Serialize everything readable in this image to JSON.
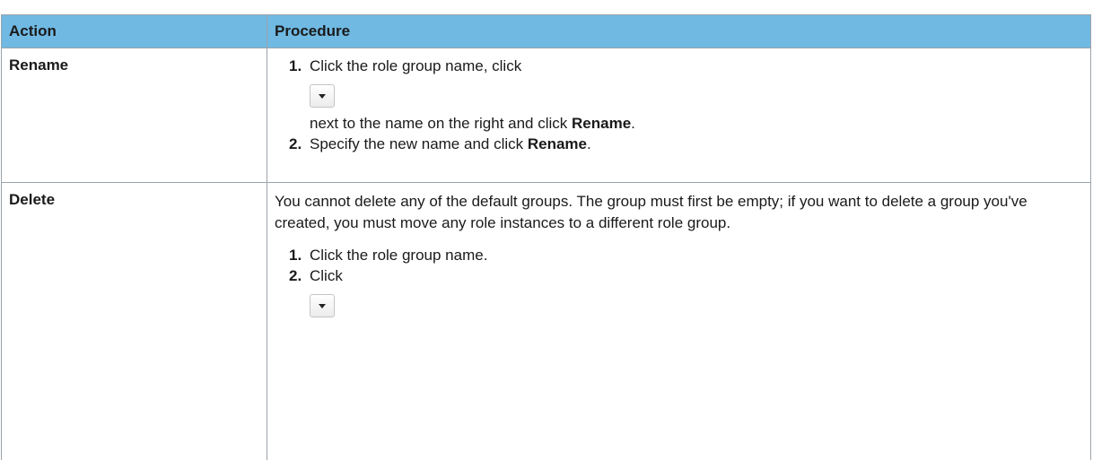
{
  "table": {
    "headers": {
      "action": "Action",
      "procedure": "Procedure"
    },
    "rows": [
      {
        "action": "Rename",
        "steps": [
          {
            "num": "1.",
            "text_before": "Click the role group name, click",
            "icon": "chevron-down-icon",
            "text_after": "next to the name on the right and click ",
            "bold_after": "Rename",
            "tail": "."
          },
          {
            "num": "2.",
            "text_before": "Specify the new name and click ",
            "bold": "Rename",
            "tail": "."
          }
        ]
      },
      {
        "action": "Delete",
        "intro": "You cannot delete any of the default groups. The group must first be empty; if you want to delete a group you've created, you must move any role instances to a different role group.",
        "steps": [
          {
            "num": "1.",
            "text": "Click the role group name."
          },
          {
            "num": "2.",
            "text": "Click",
            "icon": "chevron-down-icon"
          }
        ]
      }
    ]
  }
}
